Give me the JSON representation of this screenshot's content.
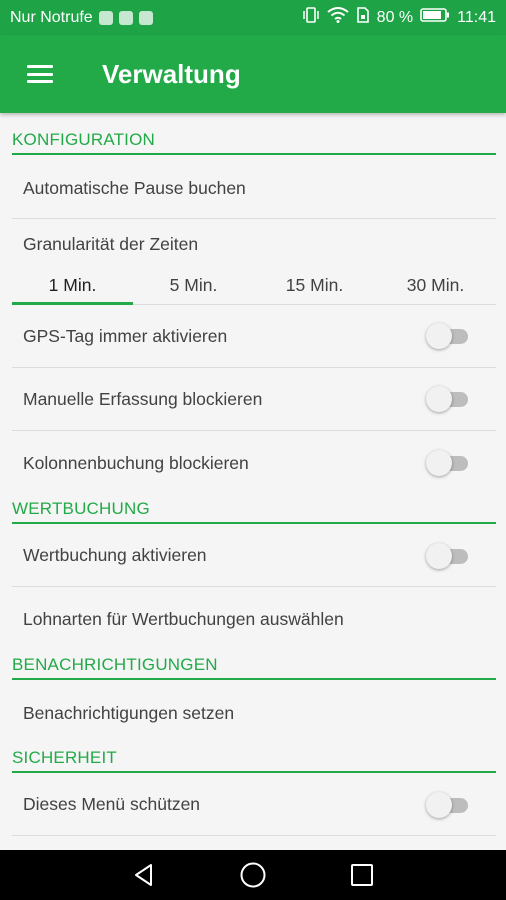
{
  "status_bar": {
    "carrier": "Nur Notrufe",
    "battery": "80 %",
    "time": "11:41",
    "icons": [
      "vibrate-icon",
      "wifi-icon",
      "sim-icon",
      "battery-icon"
    ]
  },
  "app_bar": {
    "title": "Verwaltung",
    "menu_icon": "hamburger-menu-icon"
  },
  "sections": {
    "konfiguration": {
      "header": "KONFIGURATION",
      "pause": "Automatische Pause buchen",
      "granularity": {
        "label": "Granularität der Zeiten",
        "tabs": [
          "1 Min.",
          "5 Min.",
          "15 Min.",
          "30 Min."
        ],
        "selected": "1 Min."
      },
      "gps": {
        "label": "GPS-Tag immer aktivieren",
        "enabled": false
      },
      "manual": {
        "label": "Manuelle Erfassung blockieren",
        "enabled": false
      },
      "kolonne": {
        "label": "Kolonnenbuchung blockieren",
        "enabled": false
      }
    },
    "wertbuchung": {
      "header": "WERTBUCHUNG",
      "activate": {
        "label": "Wertbuchung aktivieren",
        "enabled": false
      },
      "lohnarten": "Lohnarten für Wertbuchungen auswählen"
    },
    "benachrichtigungen": {
      "header": "BENACHRICHTIGUNGEN",
      "set": "Benachrichtigungen setzen"
    },
    "sicherheit": {
      "header": "SICHERHEIT",
      "protect": {
        "label": "Dieses Menü schützen",
        "enabled": false
      }
    }
  },
  "colors": {
    "primary": "#22aa48",
    "status_bar": "#1ea446",
    "text": "#424242",
    "divider": "#dcdcdc"
  },
  "nav_bar": {
    "buttons": [
      "back-icon",
      "home-icon",
      "recents-icon"
    ]
  }
}
